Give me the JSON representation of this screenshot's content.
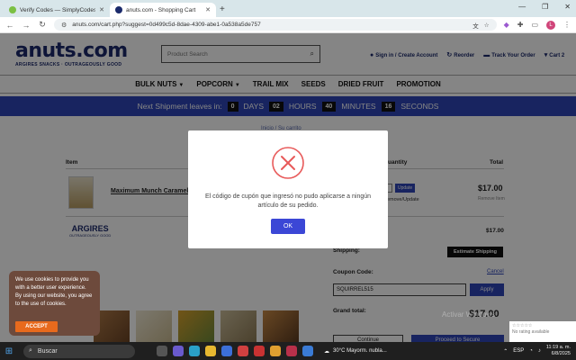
{
  "browser": {
    "tabs": [
      {
        "title": "Verify Codes — SimplyCodes",
        "favicon_color": "#7bc043",
        "active": false
      },
      {
        "title": "anuts.com - Shopping Cart",
        "favicon_color": "#1b2a6b",
        "active": true
      }
    ],
    "new_tab": "+",
    "url": "anuts.com/cart.php?suggest=0d499c5d-8dae-4309-abe1-0a538a5de757",
    "avatar_letter": "L"
  },
  "site": {
    "logo_name": "anuts.com",
    "logo_tagline": "ARGIRES SNACKS · OUTRAGEOUSLY GOOD",
    "search_placeholder": "Product Search",
    "header_links": [
      "Sign in / Create Account",
      "Reorder",
      "Track Your Order",
      "Cart"
    ],
    "cart_count": "2"
  },
  "nav": {
    "items": [
      {
        "label": "BULK NUTS",
        "dropdown": true
      },
      {
        "label": "POPCORN",
        "dropdown": true
      },
      {
        "label": "TRAIL MIX",
        "dropdown": false
      },
      {
        "label": "SEEDS",
        "dropdown": false
      },
      {
        "label": "DRIED FRUIT",
        "dropdown": false
      },
      {
        "label": "PROMOTION",
        "dropdown": false
      }
    ]
  },
  "banner": {
    "lead": "Next Shipment leaves in:",
    "days": "0",
    "days_label": "DAYS",
    "hours": "02",
    "hours_label": "HOURS",
    "minutes": "40",
    "minutes_label": "MINUTES",
    "seconds": "16",
    "seconds_label": "SECONDS"
  },
  "cart": {
    "breadcrumb": "Inicio  /  Su carrito",
    "col_item": "Item",
    "col_qty": "Quantity",
    "col_total": "Total",
    "product_name": "Maximum Munch Caramel",
    "update_label": "Update",
    "remove_label": "Remove/Update",
    "line_price": "$17.00",
    "remove_item": "Remove Item",
    "brand_name": "ARGIRES",
    "brand_tag": "OUTRAGEOUSLY GOOD",
    "subtotal": "$17.00",
    "shipping_label": "Shipping:",
    "estimate_label": "Estimate Shipping",
    "coupon_label": "Coupon Code:",
    "cancel_label": "Cancel",
    "coupon_value": "SQUIRREL515",
    "apply_label": "Apply",
    "grand_label": "Grand total:",
    "grand_value": "$17.00",
    "continue_label": "Continue",
    "proceed_label": "Proceed to Secure"
  },
  "cookie": {
    "text": "We use cookies to provide you with a better user experience. By using our website, you agree to the use of cookies.",
    "accept_label": "ACCEPT"
  },
  "modal": {
    "message": "El código de cupón que ingresó no pudo aplicarse a ningún artículo de su pedido.",
    "ok_label": "OK",
    "icon_color": "#e85a5a"
  },
  "watermark": "Activar Windows",
  "rating_text": "No rating available",
  "taskbar": {
    "search_label": "Buscar",
    "weather": "30°C  Mayorm. nubla...",
    "lang": "ESP",
    "time": "11:19 a. m.",
    "date": "6/8/2025"
  },
  "colors": {
    "brand_navy": "#1b2a6b",
    "banner_blue": "#2e46b8",
    "ok_button": "#3b47d6",
    "cookie_bg": "#6d4a3c",
    "cookie_accept": "#e86a1d"
  }
}
